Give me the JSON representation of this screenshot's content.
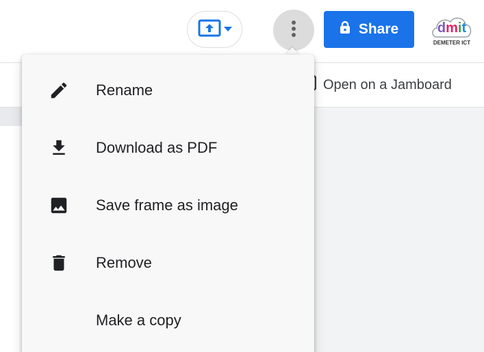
{
  "header": {
    "present_dropdown_icon": "present-to-board-icon",
    "more_options_icon": "more-vert-icon",
    "share_label": "Share",
    "share_icon": "lock-icon",
    "logo": {
      "text": "dmit",
      "subtitle": "DEMETER ICT"
    }
  },
  "toolbar": {
    "jamboard_link_label": "Open on a Jamboard"
  },
  "menu": {
    "items": [
      {
        "label": "Rename",
        "icon": "pencil-icon"
      },
      {
        "label": "Download as PDF",
        "icon": "download-icon"
      },
      {
        "label": "Save frame as image",
        "icon": "image-icon"
      },
      {
        "label": "Remove",
        "icon": "trash-icon"
      },
      {
        "label": "Make a copy",
        "icon": ""
      }
    ]
  },
  "colors": {
    "accent": "#1a73e8",
    "menu_bg": "#f8f8f8",
    "canvas_bg": "#f1f3f4"
  }
}
